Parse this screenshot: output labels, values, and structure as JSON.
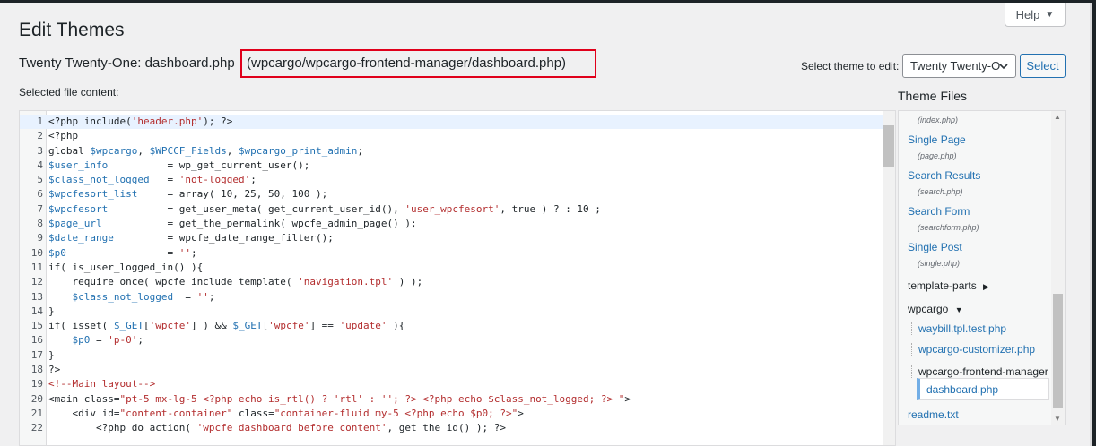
{
  "page": {
    "title": "Edit Themes",
    "help_label": "Help"
  },
  "file_heading": {
    "prefix": "Twenty Twenty-One: dashboard.php",
    "path": "(wpcargo/wpcargo-frontend-manager/dashboard.php)"
  },
  "theme_selector": {
    "label": "Select theme to edit:",
    "value": "Twenty Twenty-O",
    "button": "Select"
  },
  "selected_file_label": "Selected file content:",
  "editor": {
    "lines": [
      {
        "n": "1",
        "code": "<?php include('header.php'); ?>"
      },
      {
        "n": "2",
        "code": "<?php"
      },
      {
        "n": "3",
        "code": "global $wpcargo, $WPCCF_Fields, $wpcargo_print_admin;"
      },
      {
        "n": "4",
        "code": "$user_info          = wp_get_current_user();"
      },
      {
        "n": "5",
        "code": "$class_not_logged   = 'not-logged';"
      },
      {
        "n": "6",
        "code": "$wpcfesort_list     = array( 10, 25, 50, 100 );"
      },
      {
        "n": "7",
        "code": "$wpcfesort          = get_user_meta( get_current_user_id(), 'user_wpcfesort', true ) ? : 10 ;"
      },
      {
        "n": "8",
        "code": "$page_url           = get_the_permalink( wpcfe_admin_page() );"
      },
      {
        "n": "9",
        "code": "$date_range         = wpcfe_date_range_filter();"
      },
      {
        "n": "10",
        "code": "$p0                 = '';"
      },
      {
        "n": "11",
        "code": "if( is_user_logged_in() ){"
      },
      {
        "n": "12",
        "code": "    require_once( wpcfe_include_template( 'navigation.tpl' ) );"
      },
      {
        "n": "13",
        "code": "    $class_not_logged  = '';"
      },
      {
        "n": "14",
        "code": "}"
      },
      {
        "n": "15",
        "code": "if( isset( $_GET['wpcfe'] ) && $_GET['wpcfe'] == 'update' ){"
      },
      {
        "n": "16",
        "code": "    $p0 = 'p-0';"
      },
      {
        "n": "17",
        "code": "}"
      },
      {
        "n": "18",
        "code": "?>"
      },
      {
        "n": "19",
        "code": "<!--Main layout-->"
      },
      {
        "n": "20",
        "code": "<main class=\"pt-5 mx-lg-5 <?php echo is_rtl() ? 'rtl' : ''; ?> <?php echo $class_not_logged; ?> \">"
      },
      {
        "n": "21",
        "code": "    <div id=\"content-container\" class=\"container-fluid my-5 <?php echo $p0; ?>\">"
      },
      {
        "n": "22",
        "code": "        <?php do_action( 'wpcfe_dashboard_before_content', get_the_id() ); ?>"
      }
    ]
  },
  "theme_files": {
    "title": "Theme Files",
    "top_sub": "(index.php)",
    "items": [
      {
        "label": "Single Page",
        "sub": "(page.php)"
      },
      {
        "label": "Search Results",
        "sub": "(search.php)"
      },
      {
        "label": "Search Form",
        "sub": "(searchform.php)"
      },
      {
        "label": "Single Post",
        "sub": "(single.php)"
      }
    ],
    "folder_template_parts": "template-parts",
    "folder_wpcargo": "wpcargo",
    "wpcargo_children": [
      "waybill.tpl.test.php",
      "wpcargo-customizer.php",
      "wpcargo-frontend-manager"
    ],
    "selected_file": "dashboard.php",
    "readme": "readme.txt"
  },
  "colors": {
    "accent": "#2271b1",
    "highlight_border": "#e0001b",
    "active_line": "#e8f2ff"
  }
}
